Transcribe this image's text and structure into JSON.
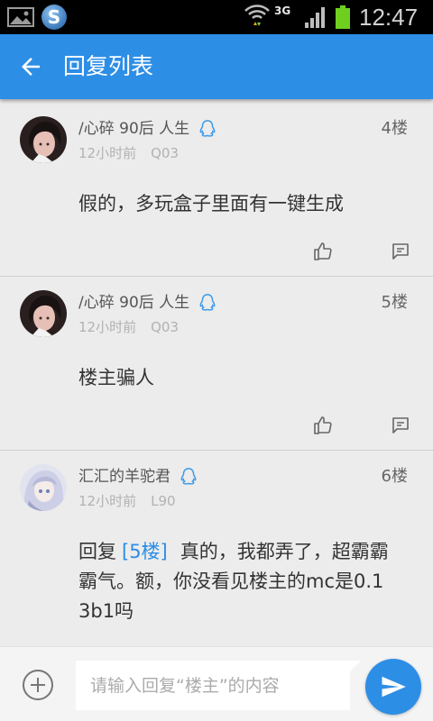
{
  "status_bar": {
    "logo_letter": "S",
    "network": "3G",
    "time": "12:47"
  },
  "app_bar": {
    "title": "回复列表"
  },
  "comments": [
    {
      "name": "/心碎 90后 人生",
      "time": "12小时前",
      "level": "Q03",
      "floor": "4楼",
      "content": "假的，多玩盒子里面有一键生成"
    },
    {
      "name": "/心碎 90后 人生",
      "time": "12小时前",
      "level": "Q03",
      "floor": "5楼",
      "content": "楼主骗人"
    },
    {
      "name": "汇汇的羊驼君",
      "time": "12小时前",
      "level": "L90",
      "floor": "6楼",
      "reply_prefix": "回复",
      "reply_ref": "[5楼]",
      "content": "真的，我都弄了，超霸霸霸气。额，你没看见楼主的mc是0.13b1吗"
    }
  ],
  "composer": {
    "placeholder": "请输入回复“楼主”的内容"
  },
  "colors": {
    "status_bar": "#000000",
    "primary": "#2d8ee6",
    "link": "#2d8ee6",
    "list_background": "#ececec",
    "divider": "#cfcfcf",
    "battery": "#6fcf1f",
    "qq_icon": "#3d9be9"
  },
  "icons": {
    "back": "arrow-left-icon",
    "qq": "qq-icon",
    "like": "thumbs-up-icon",
    "reply": "comment-icon",
    "add": "plus-circle-icon",
    "send": "send-icon",
    "status": [
      "gallery-icon",
      "app-logo-icon",
      "wifi-icon",
      "signal-icon",
      "battery-icon"
    ]
  }
}
